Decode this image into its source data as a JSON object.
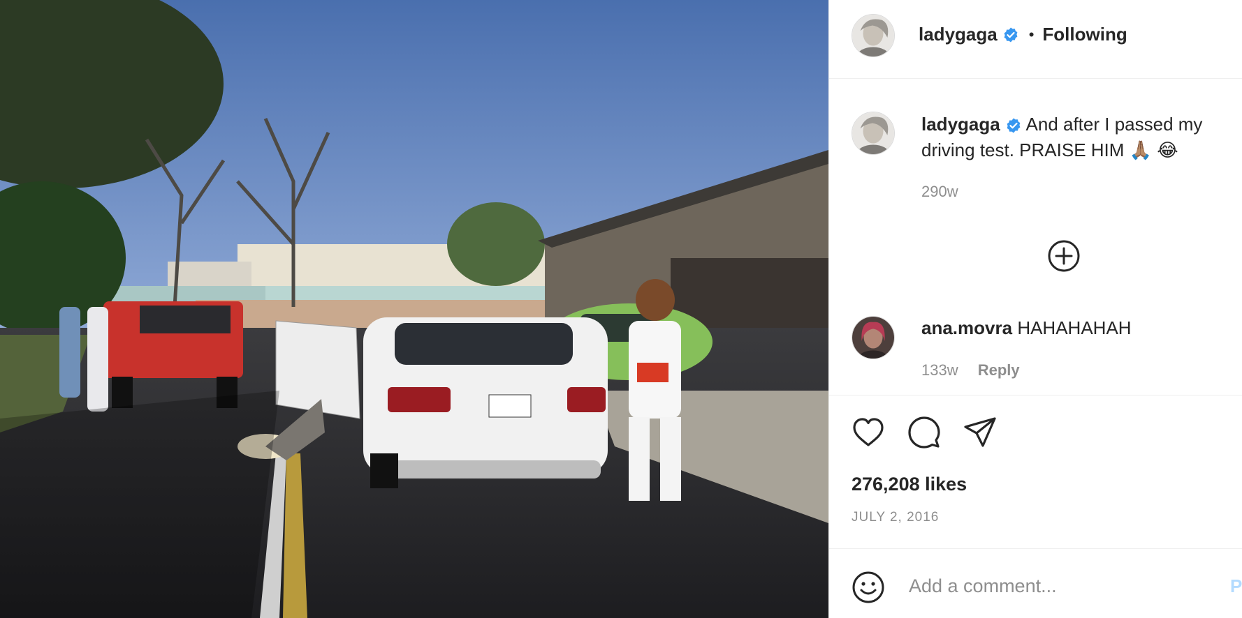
{
  "post": {
    "photo_icon": "photo"
  },
  "header": {
    "avatar_icon": "profile-picture",
    "username": "ladygaga",
    "verified_icon": "verified-badge-icon",
    "separator": "•",
    "follow_label": "Following"
  },
  "caption": {
    "username": "ladygaga",
    "text": "And after I passed my driving test. PRAISE HIM 🙏🏽 😂",
    "time": "290w"
  },
  "more_comments_icon": "plus-circle-icon",
  "comments": [
    {
      "username": "ana.movra",
      "text": "HAHAHAHAH",
      "time": "133w",
      "reply_label": "Reply"
    }
  ],
  "actions": {
    "like_icon": "heart-icon",
    "comment_icon": "comment-icon",
    "share_icon": "paper-plane-icon"
  },
  "likes": "276,208 likes",
  "date": "JULY 2, 2016",
  "add_comment": {
    "emoji_icon": "smiley-icon",
    "placeholder": "Add a comment...",
    "post_label": "Post"
  },
  "colors": {
    "verified": "#3897f0",
    "muted_text": "#8e8e8e",
    "post_button_disabled": "#b3dbff",
    "divider": "#efefef"
  }
}
